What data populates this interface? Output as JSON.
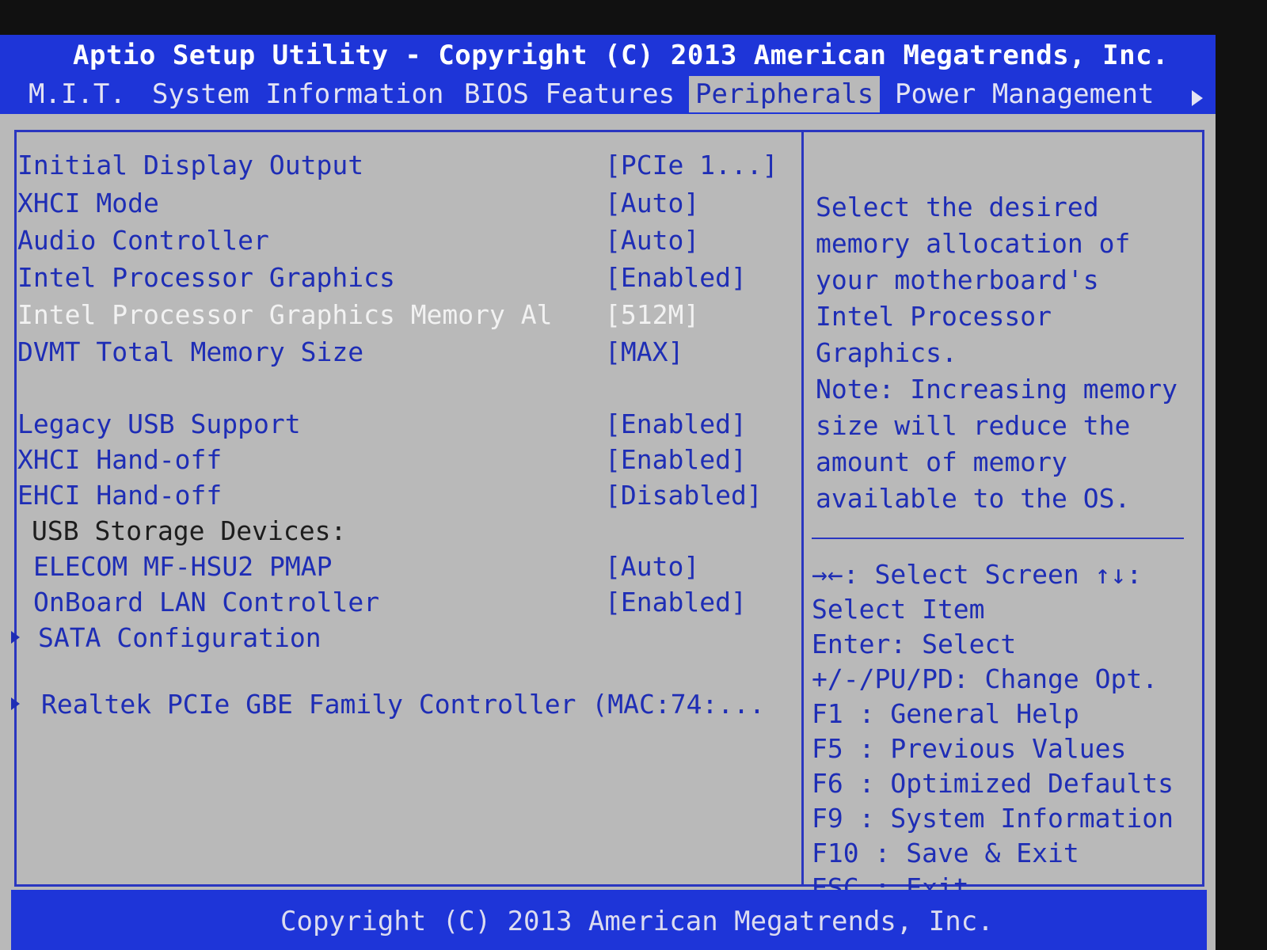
{
  "header": {
    "title": "Aptio Setup Utility - Copyright (C) 2013 American Megatrends, Inc."
  },
  "tabs": [
    {
      "label": "M.I.T."
    },
    {
      "label": "System Information"
    },
    {
      "label": "BIOS Features"
    },
    {
      "label": "Peripherals"
    },
    {
      "label": "Power Management"
    }
  ],
  "settings": [
    {
      "label": "Initial Display Output",
      "value": "[PCIe 1...]"
    },
    {
      "label": "XHCI Mode",
      "value": "[Auto]"
    },
    {
      "label": "Audio Controller",
      "value": "[Auto]"
    },
    {
      "label": "Intel Processor Graphics",
      "value": "[Enabled]"
    },
    {
      "label": "Intel Processor Graphics Memory Al",
      "value": "[512M]"
    },
    {
      "label": "DVMT Total Memory Size",
      "value": "[MAX]"
    },
    {
      "label": "Legacy USB Support",
      "value": "[Enabled]"
    },
    {
      "label": "XHCI Hand-off",
      "value": "[Enabled]"
    },
    {
      "label": "EHCI Hand-off",
      "value": "[Disabled]"
    },
    {
      "label": "USB Storage Devices:"
    },
    {
      "label": "ELECOM MF-HSU2 PMAP",
      "value": "[Auto]"
    },
    {
      "label": "OnBoard LAN Controller",
      "value": "[Enabled]"
    },
    {
      "label": "SATA Configuration"
    },
    {
      "label": "Realtek PCIe GBE Family Controller (MAC:74:..."
    }
  ],
  "help": {
    "lines": [
      "Select the desired",
      "memory allocation of",
      "your motherboard's",
      "Intel Processor",
      "Graphics.",
      "Note: Increasing memory",
      "size will reduce the",
      "amount of memory",
      "available to the OS."
    ]
  },
  "keys": [
    "→←: Select Screen  ↑↓:",
    "Select Item",
    "Enter: Select",
    "+/-/PU/PD: Change Opt.",
    "F1  : General Help",
    "F5  : Previous Values",
    "F6  : Optimized Defaults",
    "F9  : System Information",
    "F10 : Save & Exit",
    "ESC : Exit"
  ],
  "footer": {
    "text": "Copyright (C) 2013 American Megatrends, Inc."
  }
}
